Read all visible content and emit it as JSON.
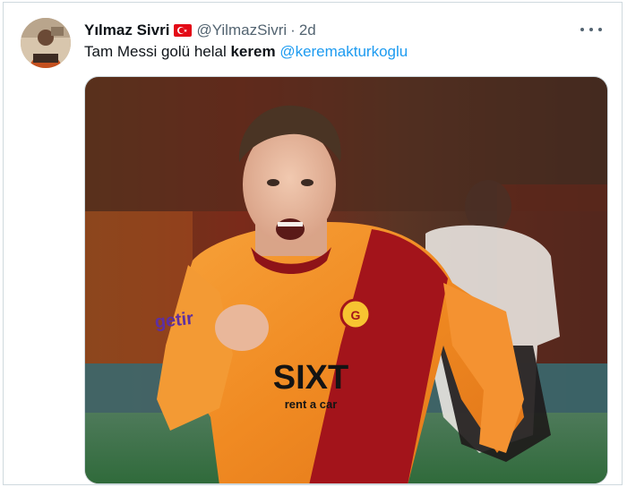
{
  "tweet": {
    "display_name": "Yılmaz Sivri",
    "handle": "@YilmazSivri",
    "separator": "·",
    "time": "2d",
    "text_before": "Tam Messi golü helal ",
    "text_bold": "kerem",
    "mention": "@keremakturkoglu",
    "flag_icon": "turkey-flag-icon",
    "more_icon": "more-horizontal-icon"
  },
  "photo": {
    "chest_sponsor": "SIXT",
    "chest_sponsor_sub": "rent a car",
    "sleeve_sponsor": "getir"
  },
  "colors": {
    "link": "#1d9bf0",
    "muted": "#536471",
    "text": "#0f1419",
    "flag_red": "#e30a17"
  }
}
